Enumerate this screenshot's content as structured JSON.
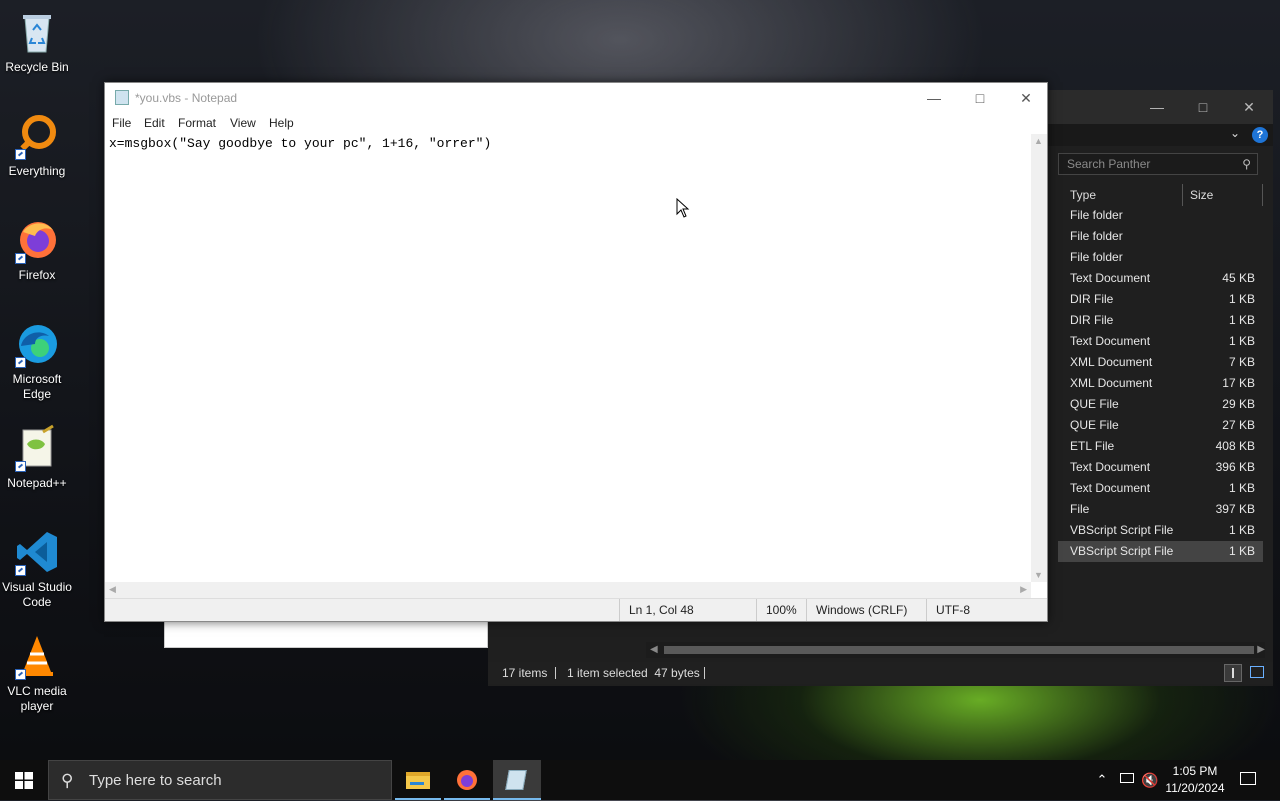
{
  "desktop": {
    "icons": [
      {
        "label_line1": "Recycle Bin",
        "label_line2": ""
      },
      {
        "label_line1": "Everything",
        "label_line2": ""
      },
      {
        "label_line1": "Firefox",
        "label_line2": ""
      },
      {
        "label_line1": "Microsoft",
        "label_line2": "Edge"
      },
      {
        "label_line1": "Notepad++",
        "label_line2": ""
      },
      {
        "label_line1": "Visual Studio",
        "label_line2": "Code"
      },
      {
        "label_line1": "VLC media",
        "label_line2": "player"
      }
    ]
  },
  "notepad": {
    "title": "*you.vbs - Notepad",
    "menu": [
      "File",
      "Edit",
      "Format",
      "View",
      "Help"
    ],
    "content": "x=msgbox(\"Say goodbye to your pc\", 1+16, \"orrer\")",
    "status": {
      "position": "Ln 1, Col 48",
      "zoom": "100%",
      "line_ending": "Windows (CRLF)",
      "encoding": "UTF-8"
    }
  },
  "explorer": {
    "search_placeholder": "Search Panther",
    "columns": {
      "type": "Type",
      "size": "Size"
    },
    "rows": [
      {
        "type": "File folder",
        "size": ""
      },
      {
        "type": "File folder",
        "size": ""
      },
      {
        "type": "File folder",
        "size": ""
      },
      {
        "type": "Text Document",
        "size": "45 KB"
      },
      {
        "type": "DIR File",
        "size": "1 KB"
      },
      {
        "type": "DIR File",
        "size": "1 KB"
      },
      {
        "type": "Text Document",
        "size": "1 KB"
      },
      {
        "type": "XML Document",
        "size": "7 KB"
      },
      {
        "type": "XML Document",
        "size": "17 KB"
      },
      {
        "type": "QUE File",
        "size": "29 KB"
      },
      {
        "type": "QUE File",
        "size": "27 KB"
      },
      {
        "type": "ETL File",
        "size": "408 KB"
      },
      {
        "type": "Text Document",
        "size": "396 KB"
      },
      {
        "type": "Text Document",
        "size": "1 KB"
      },
      {
        "type": "File",
        "size": "397 KB"
      },
      {
        "type": "VBScript Script File",
        "size": "1 KB"
      },
      {
        "type": "VBScript Script File",
        "size": "1 KB"
      }
    ],
    "status": {
      "items": "17 items",
      "selected": "1 item selected  47 bytes"
    }
  },
  "taskbar": {
    "search_placeholder": "Type here to search",
    "time": "1:05 PM",
    "date": "11/20/2024"
  }
}
